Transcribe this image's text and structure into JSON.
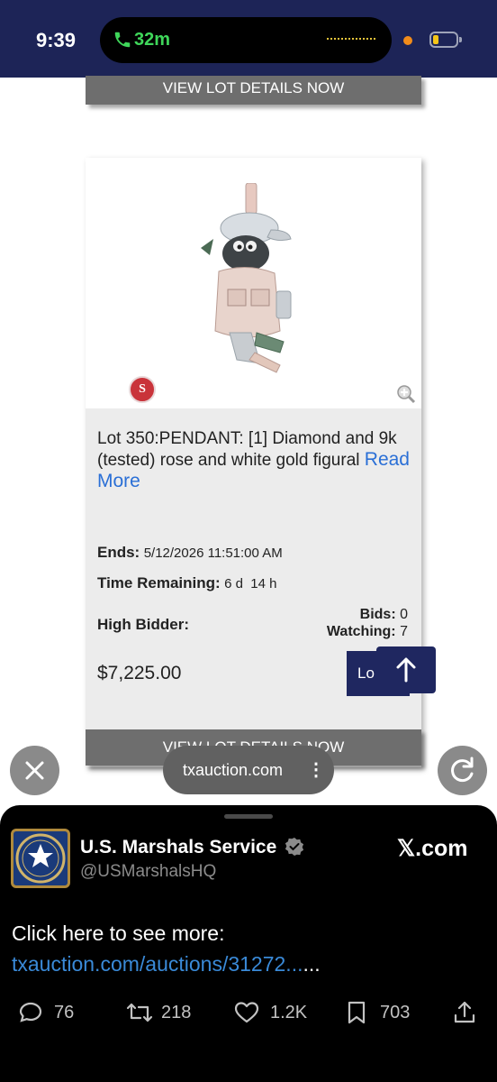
{
  "status_bar": {
    "time": "9:39",
    "call_duration": "32m"
  },
  "page": {
    "top_button_label": "VIEW LOT DETAILS NOW",
    "lot": {
      "title": "Lot 350:PENDANT: [1] Diamond and 9k (tested) rose and white gold figural",
      "read_more": "Read More",
      "ends_label": "Ends:",
      "ends_value": "5/12/2026 11:51:00 AM",
      "time_remaining_label": "Time Remaining:",
      "time_remaining_value": "6 d  14 h",
      "high_bidder_label": "High Bidder:",
      "bids_label": "Bids:",
      "bids_value": "0",
      "watching_label": "Watching:",
      "watching_value": "7",
      "price": "$7,225.00",
      "login_label": "Lo",
      "logo_text": "S"
    },
    "bottom_button_label": "VIEW LOT DETAILS NOW"
  },
  "browser": {
    "url": "txauction.com"
  },
  "tweet_sheet": {
    "account_name": "U.S. Marshals Service",
    "handle": "@USMarshalsHQ",
    "brand": "𝕏.com",
    "text_prefix": "Click here to see more: ",
    "link_text": "txauction.com/auctions/31272...",
    "text_suffix": "...",
    "replies": "76",
    "reposts": "218",
    "likes": "1.2K",
    "bookmarks": "703"
  },
  "colors": {
    "status_bar_bg": "#1d2457",
    "button_gray": "#6e6e6e",
    "navy_button": "#1f2760",
    "link_blue": "#2a6fd6",
    "sheet_bg": "#000000"
  }
}
